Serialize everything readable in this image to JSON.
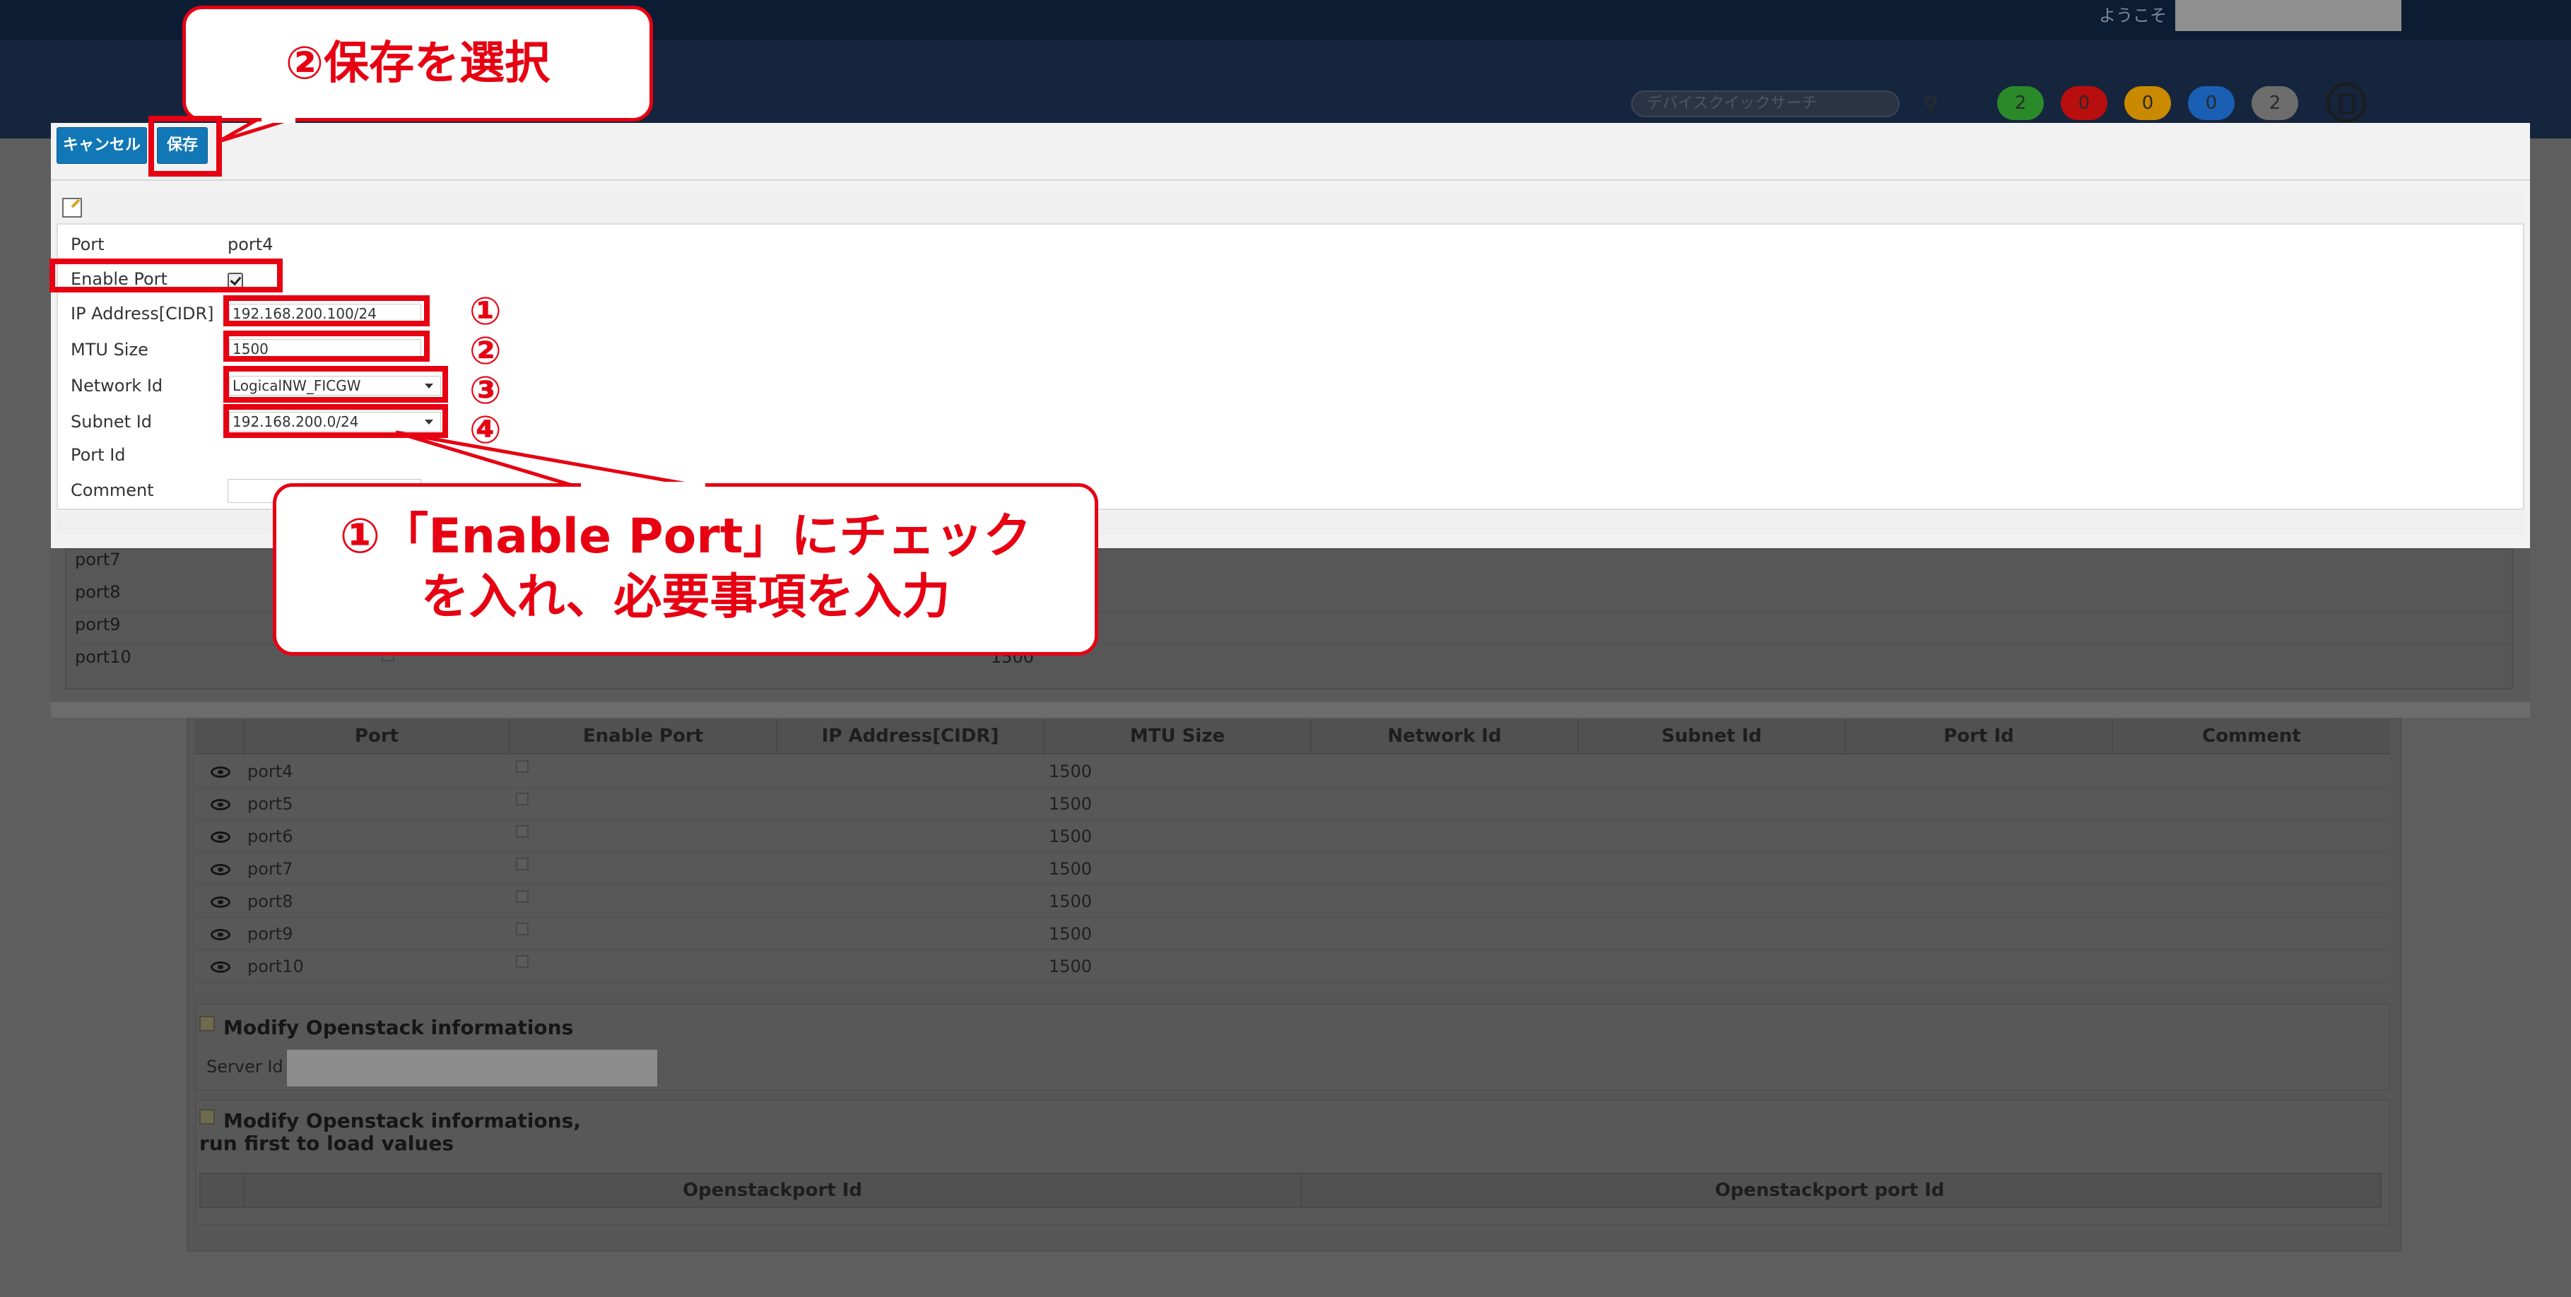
{
  "header": {
    "welcome_text": "ようこそ",
    "search_placeholder": "デバイスクイックサーチ",
    "badges": [
      {
        "count": "2",
        "color": "#2a8a2a"
      },
      {
        "count": "0",
        "color": "#b80e0e"
      },
      {
        "count": "0",
        "color": "#c98a00"
      },
      {
        "count": "0",
        "color": "#1a5fb4"
      },
      {
        "count": "2",
        "color": "#6d6d6d"
      }
    ]
  },
  "modal": {
    "cancel_label": "キャンセル",
    "save_label": "保存",
    "fields": {
      "port_label": "Port",
      "port_value": "port4",
      "enable_label": "Enable Port",
      "ip_label": "IP Address[CIDR]",
      "ip_value": "192.168.200.100/24",
      "mtu_label": "MTU Size",
      "mtu_value": "1500",
      "network_label": "Network Id",
      "network_value": "LogicalNW_FICGW",
      "subnet_label": "Subnet Id",
      "subnet_value": "192.168.200.0/24",
      "portid_label": "Port Id",
      "comment_label": "Comment"
    },
    "lower_rows": [
      {
        "port": "port7",
        "mtu": ""
      },
      {
        "port": "port8",
        "mtu": ""
      },
      {
        "port": "port9",
        "mtu": ""
      },
      {
        "port": "port10",
        "mtu": "1500"
      }
    ]
  },
  "background_table": {
    "columns": [
      "Port",
      "Enable Port",
      "IP Address[CIDR]",
      "MTU Size",
      "Network Id",
      "Subnet Id",
      "Port Id",
      "Comment"
    ],
    "rows": [
      {
        "port": "port4",
        "mtu": "1500"
      },
      {
        "port": "port5",
        "mtu": "1500"
      },
      {
        "port": "port6",
        "mtu": "1500"
      },
      {
        "port": "port7",
        "mtu": "1500"
      },
      {
        "port": "port8",
        "mtu": "1500"
      },
      {
        "port": "port9",
        "mtu": "1500"
      },
      {
        "port": "port10",
        "mtu": "1500"
      }
    ]
  },
  "openstack": {
    "modify_title": "Modify Openstack informations",
    "server_id_label": "Server Id",
    "modify_title2_line1": "Modify Openstack informations,",
    "modify_title2_line2": "run first to load values",
    "col1": "Openstackport Id",
    "col2": "Openstackport port Id"
  },
  "annotations": {
    "save_callout": "②保存を選択",
    "input_callout_line1": "①「Enable Port」にチェック",
    "input_callout_line2": "を入れ、必要事項を入力",
    "marks": [
      "①",
      "②",
      "③",
      "④"
    ],
    "color": "#e60012"
  }
}
